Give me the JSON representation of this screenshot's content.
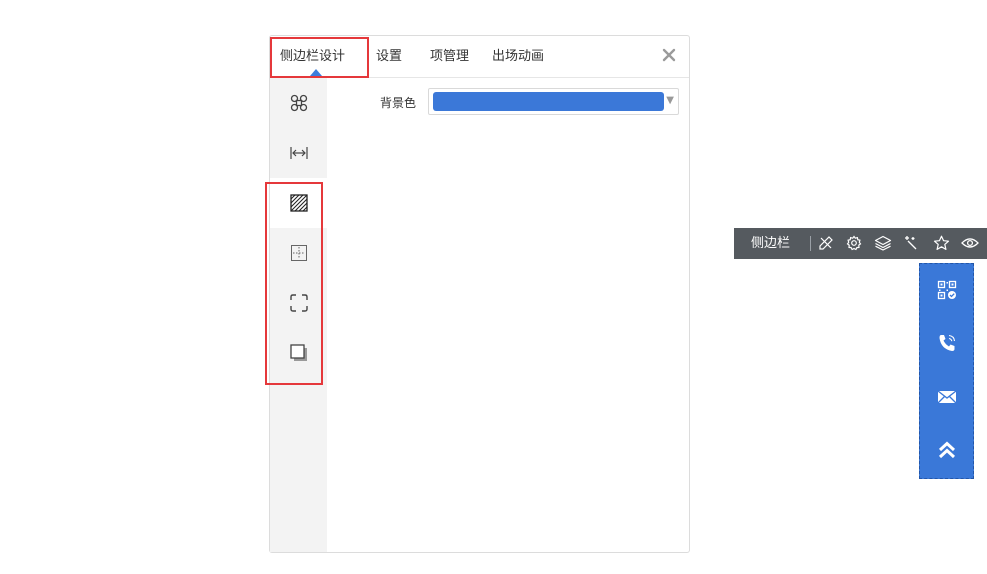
{
  "panel": {
    "tabs": [
      {
        "label": "侧边栏设计"
      },
      {
        "label": "设置"
      },
      {
        "label": "项管理"
      },
      {
        "label": "出场动画"
      }
    ],
    "close_icon": "close-icon",
    "rail_icons": [
      "layout-command-icon",
      "width-arrows-icon",
      "background-pattern-icon",
      "padding-icon",
      "border-corners-icon",
      "shadow-icon"
    ],
    "active_rail_index": 2,
    "field": {
      "label": "背景色",
      "value_color": "#3b78d8"
    }
  },
  "toolbar": {
    "title": "侧边栏",
    "icons": [
      "design-tools-icon",
      "settings-gear-icon",
      "layers-icon",
      "magic-wand-icon",
      "star-icon",
      "eye-icon"
    ]
  },
  "sidebar_widget": {
    "background": "#3a78d8",
    "items": [
      "qrcode-icon",
      "phone-icon",
      "mail-icon",
      "back-to-top-icon"
    ]
  },
  "colors": {
    "accent": "#3b7ddd",
    "highlight": "#e5383b",
    "toolbar_bg": "#555a5f"
  }
}
